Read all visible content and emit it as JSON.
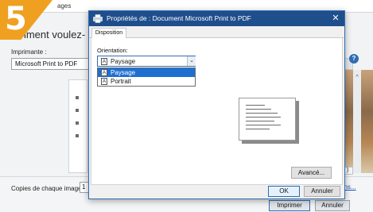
{
  "step": {
    "number": "5",
    "color": "#f0a020"
  },
  "background_window": {
    "title_fragment": "ages",
    "heading": "mment voulez-",
    "printer_label": "Imprimante :",
    "printer_value": "Microsoft Print to PDF",
    "help_icon": "?",
    "copies_label": "Copies de chaque image :",
    "copies_value": "1",
    "options_link": "ons...",
    "print_button": "Imprimer",
    "cancel_button": "Annuler",
    "mini_button": ")"
  },
  "dialog": {
    "title": "Propriétés de : Document Microsoft Print to PDF",
    "close_icon": "✕",
    "tabs": [
      {
        "label": "Disposition",
        "active": true
      }
    ],
    "orientation": {
      "label": "Orientation:",
      "selected": "Paysage",
      "icon_glyph": "A",
      "options": [
        {
          "label": "Paysage",
          "highlighted": true
        },
        {
          "label": "Portrait",
          "highlighted": false
        }
      ]
    },
    "advanced_button": "Avancé...",
    "ok_button": "OK",
    "cancel_button": "Annuler"
  },
  "colors": {
    "titlebar": "#1f4e8c",
    "highlight": "#1f6fd1",
    "accent": "#2f6db3"
  }
}
